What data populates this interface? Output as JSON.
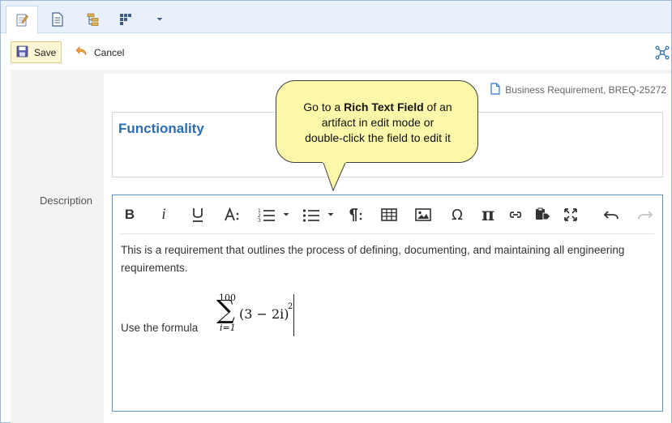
{
  "tabs": [
    {
      "icon": "edit-document-icon",
      "active": true
    },
    {
      "icon": "document-icon",
      "active": false
    },
    {
      "icon": "tree-icon",
      "active": false
    },
    {
      "icon": "grid-icon",
      "active": false
    },
    {
      "icon": "dropdown-arrow-icon",
      "active": false
    }
  ],
  "actions": {
    "save_label": "Save",
    "cancel_label": "Cancel"
  },
  "artifact": {
    "reference": "Business Requirement, BREQ-25272",
    "name": "Functionality"
  },
  "description": {
    "label": "Description",
    "body": "This is a requirement that outlines the process of defining, documenting, and maintaining all engineering requirements.",
    "formula_label": "Use the formula",
    "formula": {
      "upper": "100",
      "lower": "i=1",
      "expression": "(3 − 2i)",
      "exponent": "2"
    }
  },
  "toolbar": [
    "bold",
    "italic",
    "underline",
    "font-size",
    "ordered-list",
    "ordered-list-dropdown",
    "unordered-list",
    "unordered-list-dropdown",
    "paragraph-format",
    "table",
    "image",
    "special-characters",
    "math-formula",
    "link",
    "paste-special",
    "fullscreen",
    "undo",
    "redo"
  ],
  "callout": {
    "line1_prefix": "Go to a ",
    "line1_bold": "Rich Text Field",
    "line1_suffix": " of an",
    "line2": "artifact in edit mode or",
    "line3": "double-click the field to edit it"
  },
  "colors": {
    "accent": "#2a6db0",
    "editor_border": "#5a95c8",
    "callout_fill": "#fbf8aa",
    "save_fill": "#fbf7d4"
  }
}
